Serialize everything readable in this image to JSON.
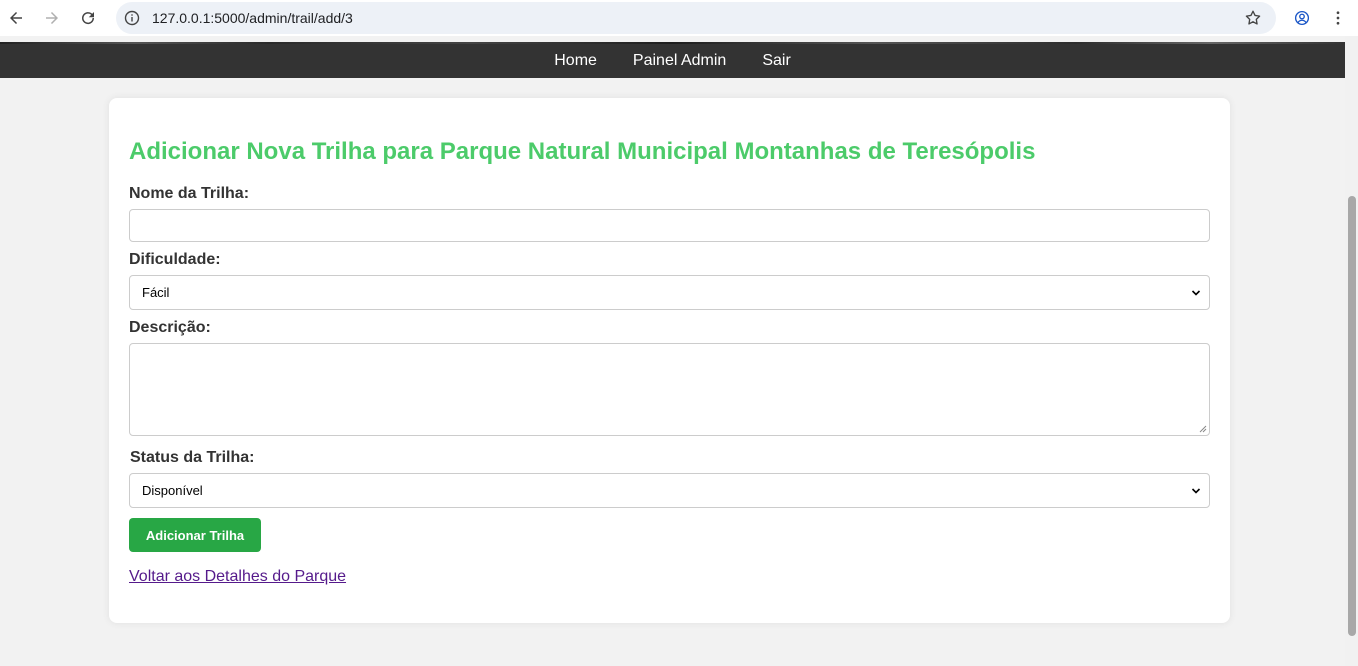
{
  "browser": {
    "url": "127.0.0.1:5000/admin/trail/add/3",
    "icons": [
      "back-arrow-icon",
      "forward-arrow-icon",
      "reload-icon",
      "info-icon",
      "star-icon",
      "profile-icon",
      "more-vert-icon"
    ]
  },
  "nav": {
    "items": [
      {
        "label": "Home"
      },
      {
        "label": "Painel Admin"
      },
      {
        "label": "Sair"
      }
    ]
  },
  "form": {
    "title": "Adicionar Nova Trilha para Parque Natural Municipal Montanhas de Teresópolis",
    "name_label": "Nome da Trilha:",
    "name_value": "",
    "difficulty_label": "Dificuldade:",
    "difficulty_value": "Fácil",
    "description_label": "Descrição:",
    "description_value": "",
    "status_label": "Status da Trilha:",
    "status_value": "Disponível",
    "submit_label": "Adicionar Trilha",
    "back_link": "Voltar aos Detalhes do Parque"
  },
  "colors": {
    "title": "#4ccb6a",
    "nav_bg": "#333333",
    "button": "#28a745",
    "link": "#551a8b"
  }
}
